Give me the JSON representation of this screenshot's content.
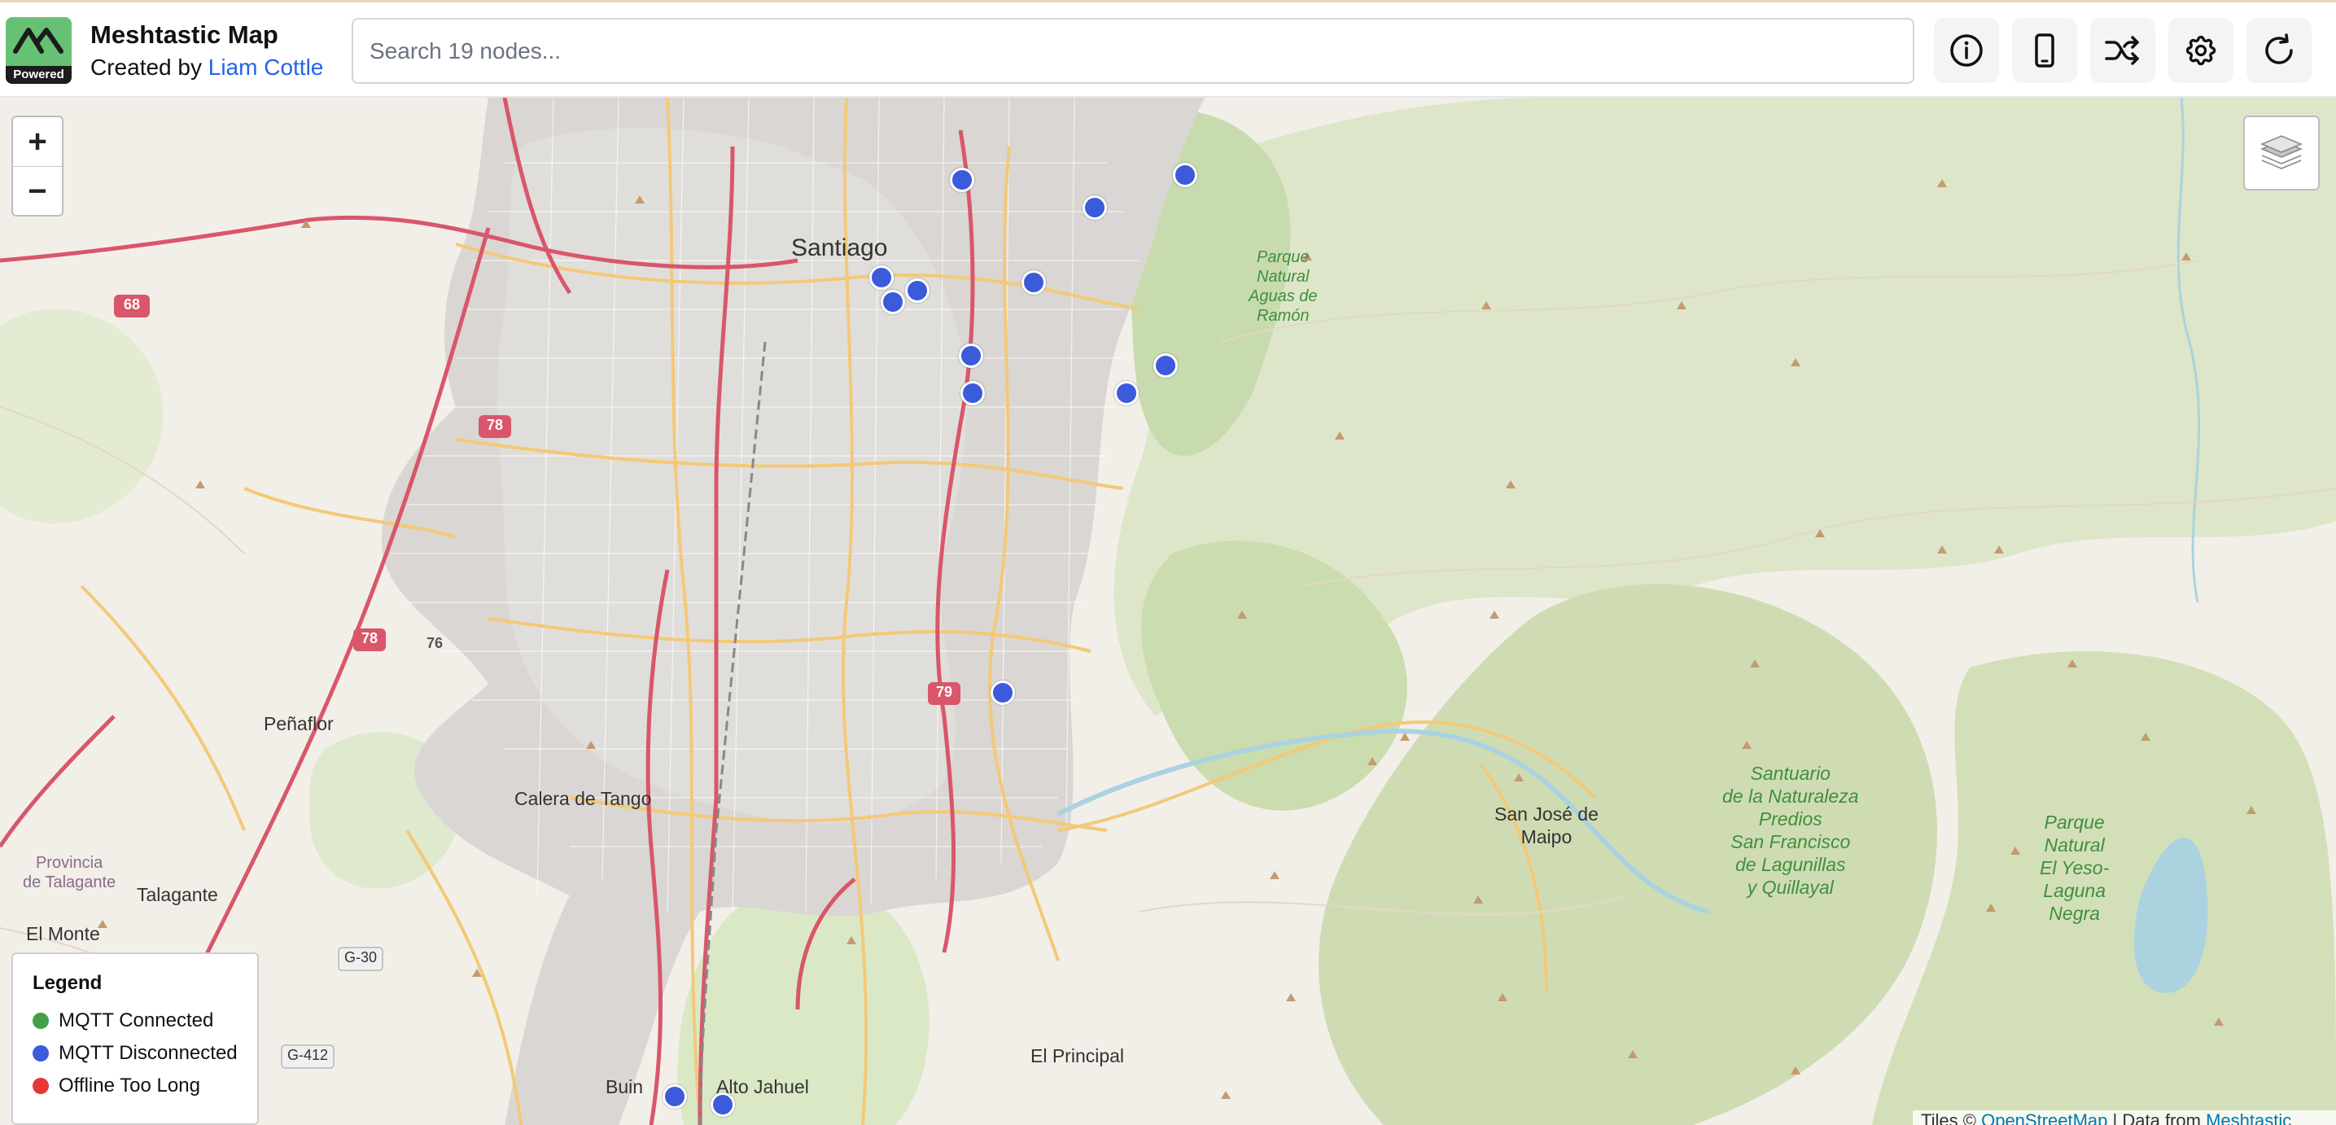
{
  "header": {
    "logo_text": "Powered",
    "title": "Meshtastic Map",
    "subtitle_prefix": "Created by",
    "author": "Liam Cottle",
    "search_placeholder": "Search 19 nodes...",
    "buttons": [
      "info-icon",
      "device-icon",
      "shuffle-icon",
      "gear-icon",
      "refresh-icon"
    ]
  },
  "map": {
    "zoom_in": "+",
    "zoom_out": "−",
    "labels": {
      "santiago": "Santiago",
      "penaflor": "Peñaflor",
      "calera": "Calera de Tango",
      "talagante": "Talagante",
      "elmonte": "El Monte",
      "prov1": "Provincia",
      "prov2": "de Talagante",
      "sanjose1": "San José de",
      "sanjose2": "Maipo",
      "elprincipal": "El Principal",
      "buin": "Buin",
      "altojahuel": "Alto Jahuel",
      "park1_1": "Parque",
      "park1_2": "Natural",
      "park1_3": "Aguas de",
      "park1_4": "Ramón",
      "sant1": "Santuario",
      "sant2": "de la Naturaleza",
      "sant3": "Predios",
      "sant4": "San Francisco",
      "sant5": "de Lagunillas",
      "sant6": "y Quillayal",
      "yeso1": "Parque",
      "yeso2": "Natural",
      "yeso3": "El Yeso-",
      "yeso4": "Laguna",
      "yeso5": "Negra"
    },
    "shields": [
      "68",
      "78",
      "78",
      "76",
      "79",
      "G-30",
      "G-412"
    ]
  },
  "legend": {
    "title": "Legend",
    "items": [
      {
        "label": "MQTT Connected",
        "color": "#43a047"
      },
      {
        "label": "MQTT Disconnected",
        "color": "#3b5bdb"
      },
      {
        "label": "Offline Too Long",
        "color": "#e53935"
      }
    ]
  },
  "attribution": {
    "tiles_prefix": "Tiles ©",
    "tiles_link": "OpenStreetMap",
    "data_prefix": "| Data from",
    "data_link": "Meshtastic"
  }
}
